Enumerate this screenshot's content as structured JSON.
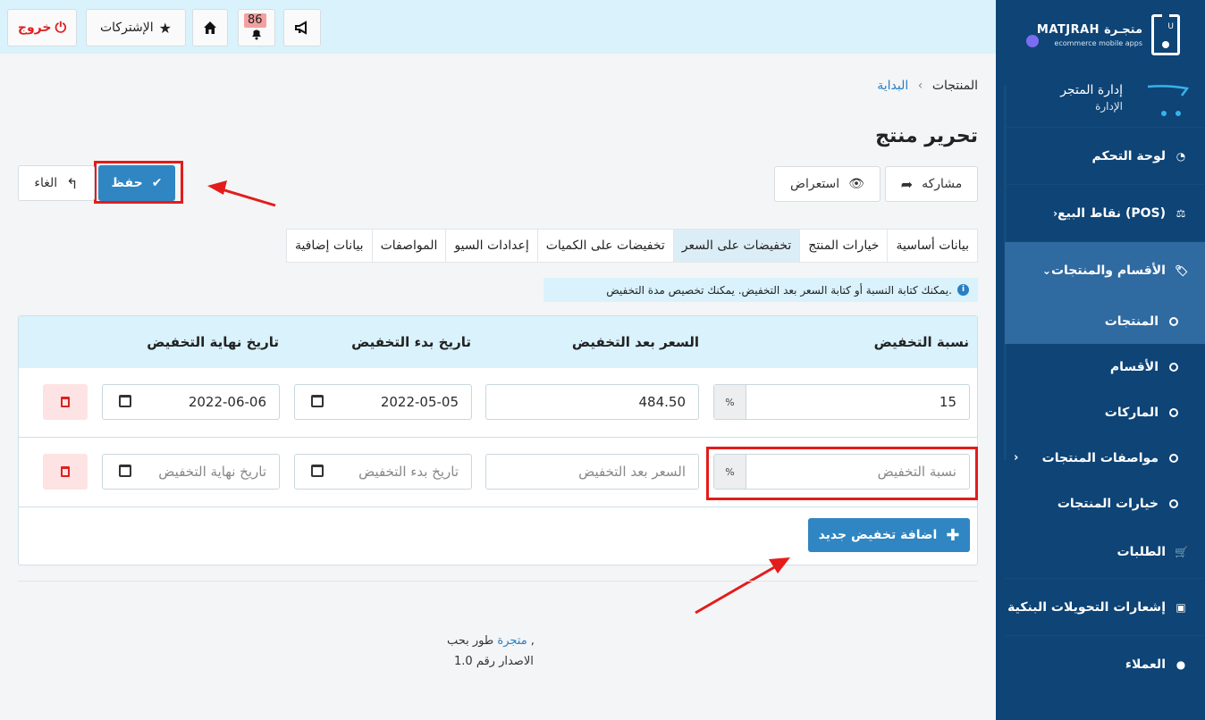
{
  "topbar": {
    "logout_label": "خروج",
    "subscriptions_label": "الإشتركات",
    "notifications_count": "86"
  },
  "brand": {
    "name": "MATJRAH متجـرة",
    "tagline": "ecommerce mobile apps"
  },
  "store": {
    "title": "إدارة المتجر",
    "subtitle": "الإدارة"
  },
  "sidebar": {
    "dashboard": "لوحة التحكم",
    "pos": "نقاط البيع (POS)",
    "categories_products": "الأقسام والمنتجات",
    "products": "المنتجات",
    "categories": "الأقسام",
    "brands": "الماركات",
    "product_specs": "مواصفات المنتجات",
    "product_options": "خيارات المنتجات",
    "orders": "الطلبات",
    "bank_transfers": "إشعارات التحويلات البنكية",
    "customers": "العملاء"
  },
  "breadcrumb": {
    "home": "البداية",
    "current": "المنتجات"
  },
  "page_title": "تحرير منتج",
  "actions": {
    "share": "مشاركه",
    "preview": "استعراض",
    "save": "حفظ",
    "cancel": "الغاء"
  },
  "tabs": [
    "بيانات أساسية",
    "خيارات المنتج",
    "تخفيضات على السعر",
    "تخفيضات على الكميات",
    "إعدادات السيو",
    "المواصفات",
    "بيانات إضافية"
  ],
  "info_text": "يمكنك كتابة النسبة أو كتابة السعر بعد التخفيض. يمكنك تخصيص مدة التخفيض.",
  "table": {
    "headers": [
      "نسبة التخفيض",
      "السعر بعد التخفيض",
      "تاريخ بدء التخفيض",
      "تاريخ نهاية التخفيض"
    ],
    "row1": {
      "percent": "15",
      "price": "484.50",
      "start": "2022-05-05",
      "end": "2022-06-06"
    },
    "row2_placeholders": {
      "percent": "نسبة التخفيض",
      "price": "السعر بعد التخفيض",
      "start": "تاريخ بدء التخفيض",
      "end": "تاريخ نهاية التخفيض"
    },
    "percent_symbol": "%"
  },
  "add_discount_label": "اضافة تخفيض جديد",
  "footer": {
    "dev_prefix": "طور بحب ,",
    "dev_link": "متجرة",
    "version": "الاصدار رقم 1.0"
  }
}
